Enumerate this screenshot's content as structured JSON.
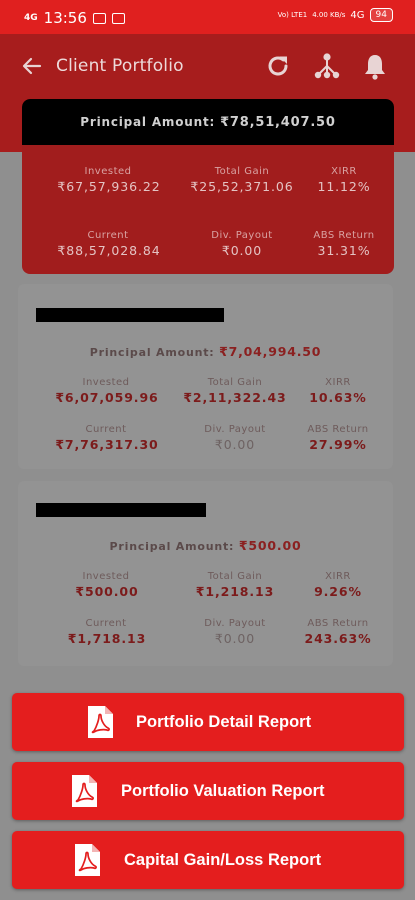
{
  "status_bar": {
    "signal": "4G",
    "time": "13:56",
    "network": "4G",
    "lte": "Vo) LTE1",
    "speed": "4.00 KB/s",
    "battery": "94"
  },
  "header": {
    "title": "Client Portfolio"
  },
  "summary": {
    "principal_label": "Principal Amount:",
    "principal_value": "₹78,51,407.50",
    "invested_label": "Invested",
    "invested_value": "₹67,57,936.22",
    "total_gain_label": "Total Gain",
    "total_gain_value": "₹25,52,371.06",
    "xirr_label": "XIRR",
    "xirr_value": "11.12%",
    "current_label": "Current",
    "current_value": "₹88,57,028.84",
    "div_payout_label": "Div. Payout",
    "div_payout_value": "₹0.00",
    "abs_return_label": "ABS Return",
    "abs_return_value": "31.31%"
  },
  "clients": [
    {
      "principal_label": "Principal Amount:",
      "principal_value": "₹7,04,994.50",
      "invested_label": "Invested",
      "invested_value": "₹6,07,059.96",
      "total_gain_label": "Total Gain",
      "total_gain_value": "₹2,11,322.43",
      "xirr_label": "XIRR",
      "xirr_value": "10.63%",
      "current_label": "Current",
      "current_value": "₹7,76,317.30",
      "div_payout_label": "Div. Payout",
      "div_payout_value": "₹0.00",
      "abs_return_label": "ABS Return",
      "abs_return_value": "27.99%"
    },
    {
      "principal_label": "Principal Amount:",
      "principal_value": "₹500.00",
      "invested_label": "Invested",
      "invested_value": "₹500.00",
      "total_gain_label": "Total Gain",
      "total_gain_value": "₹1,218.13",
      "xirr_label": "XIRR",
      "xirr_value": "9.26%",
      "current_label": "Current",
      "current_value": "₹1,718.13",
      "div_payout_label": "Div. Payout",
      "div_payout_value": "₹0.00",
      "abs_return_label": "ABS Return",
      "abs_return_value": "243.63%"
    }
  ],
  "reports": {
    "detail_label": "Portfolio Detail Report",
    "valuation_label": "Portfolio Valuation Report",
    "capital_gain_label": "Capital Gain/Loss Report"
  },
  "colors": {
    "accent": "#e41e1e",
    "overlay": "#8f8f8f",
    "header_bg": "#a71d1d"
  },
  "icons": [
    "back-arrow-icon",
    "refresh-icon",
    "network-icon",
    "bell-icon",
    "pdf-icon"
  ]
}
